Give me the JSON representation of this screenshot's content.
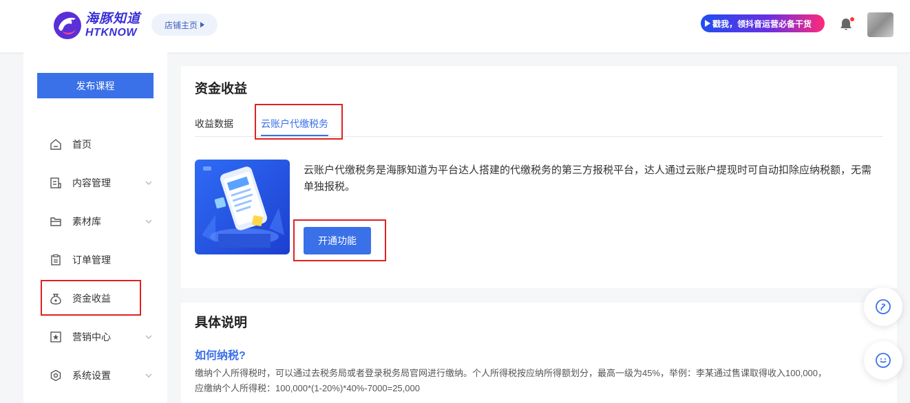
{
  "header": {
    "logo_cn": "海豚知道",
    "logo_en": "HTKNOW",
    "store_home": "店铺主页",
    "promo": "戳我，领抖音运营必备干货"
  },
  "sidebar": {
    "publish": "发布课程",
    "items": [
      {
        "label": "首页",
        "icon": "home-icon"
      },
      {
        "label": "内容管理",
        "icon": "content-icon",
        "expandable": true
      },
      {
        "label": "素材库",
        "icon": "folder-icon",
        "expandable": true
      },
      {
        "label": "订单管理",
        "icon": "clipboard-icon"
      },
      {
        "label": "资金收益",
        "icon": "money-bag-icon",
        "active": true
      },
      {
        "label": "营销中心",
        "icon": "star-icon",
        "expandable": true
      },
      {
        "label": "系统设置",
        "icon": "settings-icon",
        "expandable": true
      }
    ]
  },
  "main": {
    "title": "资金收益",
    "tabs": [
      {
        "label": "收益数据"
      },
      {
        "label": "云账户代缴税务",
        "active": true
      }
    ],
    "description": "云账户代缴税务是海豚知道为平台达人搭建的代缴税务的第三方报税平台，达人通过云账户提现时可自动扣除应纳税额，无需单独报税。",
    "open_button": "开通功能"
  },
  "details": {
    "title": "具体说明",
    "subheading": "如何纳税?",
    "paragraph_line1": "缴纳个人所得税时，可以通过去税务局或者登录税务局官网进行缴纳。个人所得税按应纳所得额划分，最高一级为45%，举例：李某通过售课取得收入100,000，",
    "paragraph_line2": "应缴纳个人所得税：100,000*(1-20%)*40%-7000=25,000"
  },
  "colors": {
    "accent": "#3a70e8",
    "highlight": "#e02020"
  }
}
